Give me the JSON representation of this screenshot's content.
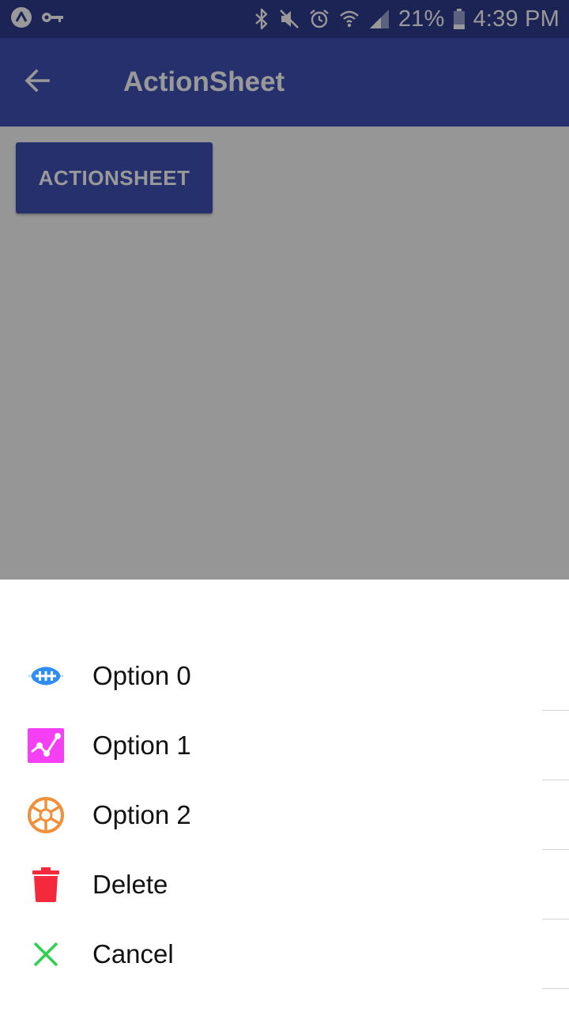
{
  "status_bar": {
    "battery_percent": "21%",
    "time": "4:39 PM",
    "icons": [
      "app-logo-icon",
      "key-icon",
      "bluetooth-icon",
      "mute-icon",
      "alarm-icon",
      "wifi-icon",
      "signal-icon",
      "battery-icon"
    ]
  },
  "app_bar": {
    "title": "ActionSheet",
    "back_icon": "arrow-back-icon"
  },
  "main": {
    "button_label": "ACTIONSHEET"
  },
  "action_sheet": {
    "items": [
      {
        "label": "Option 0",
        "icon": "football-icon",
        "color": "#2f8ef5"
      },
      {
        "label": "Option 1",
        "icon": "analytics-icon",
        "color": "#f43ff4"
      },
      {
        "label": "Option 2",
        "icon": "aperture-icon",
        "color": "#f0903a"
      },
      {
        "label": "Delete",
        "icon": "trash-icon",
        "color": "#f4293b"
      },
      {
        "label": "Cancel",
        "icon": "close-icon",
        "color": "#2fd04e"
      }
    ]
  },
  "colors": {
    "primary": "#3f51b5",
    "status_bar": "#2f3c8f",
    "overlay": "rgba(0,0,0,0.4)"
  }
}
